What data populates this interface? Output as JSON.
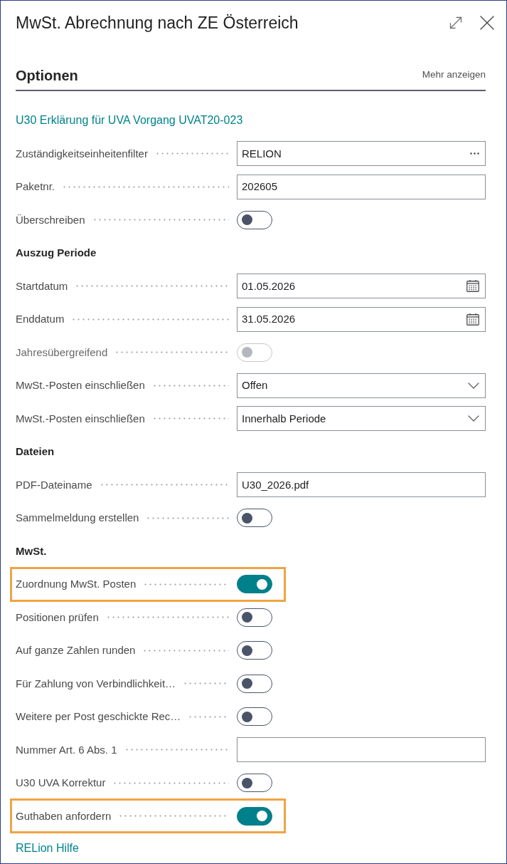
{
  "window": {
    "title": "MwSt. Abrechnung nach ZE Österreich"
  },
  "section": {
    "title": "Optionen",
    "show_more": "Mehr anzeigen"
  },
  "report_link": "U30 Erklärung für UVA Vorgang UVAT20-023",
  "fields": [
    {
      "kind": "lookup",
      "label": "Zuständigkeitseinheitenfilter",
      "value": "RELION",
      "highlighted": false
    },
    {
      "kind": "text",
      "label": "Paketnr.",
      "value": "202605",
      "highlighted": false
    },
    {
      "kind": "toggle",
      "label": "Überschreiben",
      "on": false,
      "disabled": false,
      "highlighted": false
    },
    {
      "kind": "heading",
      "label": "Auszug Periode",
      "highlighted": false
    },
    {
      "kind": "date",
      "label": "Startdatum",
      "value": "01.05.2026",
      "highlighted": false
    },
    {
      "kind": "date",
      "label": "Enddatum",
      "value": "31.05.2026",
      "highlighted": false
    },
    {
      "kind": "toggle",
      "label": "Jahresübergreifend",
      "on": false,
      "disabled": true,
      "highlighted": false
    },
    {
      "kind": "select",
      "label": "MwSt.-Posten einschließen",
      "value": "Offen",
      "highlighted": false
    },
    {
      "kind": "select",
      "label": "MwSt.-Posten einschließen",
      "value": "Innerhalb Periode",
      "highlighted": false
    },
    {
      "kind": "heading",
      "label": "Dateien",
      "highlighted": false
    },
    {
      "kind": "text",
      "label": "PDF-Dateiname",
      "value": "U30_2026.pdf",
      "highlighted": false
    },
    {
      "kind": "toggle",
      "label": "Sammelmeldung erstellen",
      "on": false,
      "disabled": false,
      "highlighted": false
    },
    {
      "kind": "heading",
      "label": "MwSt.",
      "highlighted": false
    },
    {
      "kind": "toggle",
      "label": "Zuordnung MwSt. Posten",
      "on": true,
      "disabled": false,
      "highlighted": true
    },
    {
      "kind": "toggle",
      "label": "Positionen prüfen",
      "on": false,
      "disabled": false,
      "highlighted": false
    },
    {
      "kind": "toggle",
      "label": "Auf ganze Zahlen runden",
      "on": false,
      "disabled": false,
      "highlighted": false
    },
    {
      "kind": "toggle",
      "label": "Für Zahlung von Verbindlichkeit…",
      "on": false,
      "disabled": false,
      "highlighted": false
    },
    {
      "kind": "toggle",
      "label": "Weitere per Post geschickte Rec…",
      "on": false,
      "disabled": false,
      "highlighted": false
    },
    {
      "kind": "text",
      "label": "Nummer Art. 6 Abs. 1",
      "highlighted": false
    },
    {
      "kind": "toggle",
      "label": "U30 UVA Korrektur",
      "on": false,
      "disabled": false,
      "highlighted": false
    },
    {
      "kind": "toggle",
      "label": "Guthaben anfordern",
      "on": true,
      "disabled": false,
      "highlighted": true
    }
  ],
  "help_link": "RELion Hilfe"
}
